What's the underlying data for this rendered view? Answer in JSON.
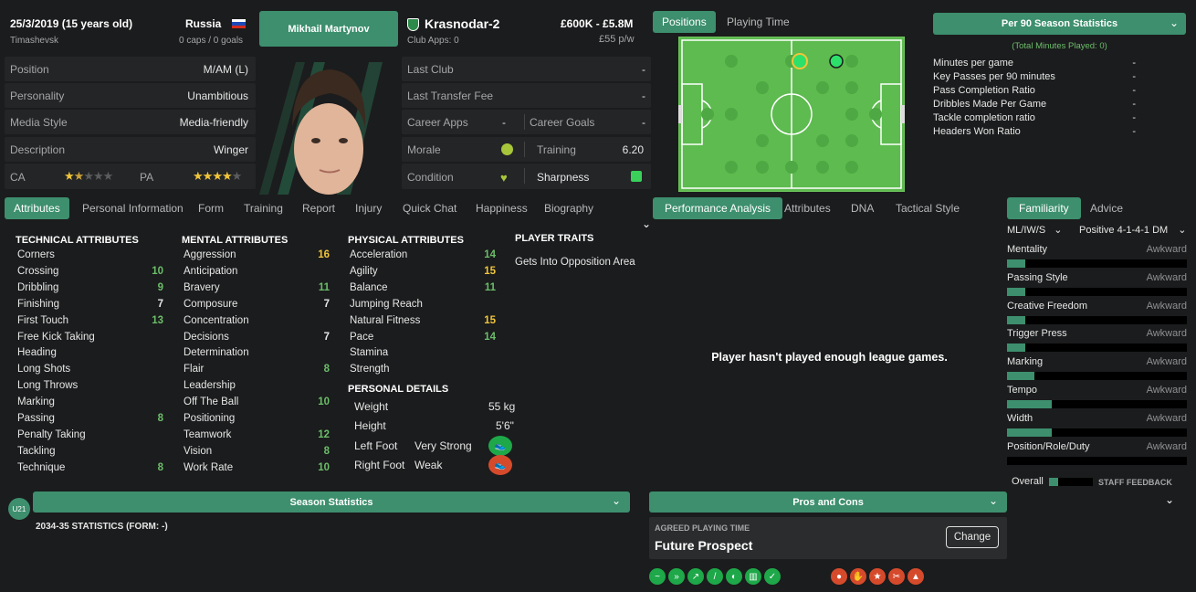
{
  "header": {
    "dob": "25/3/2019 (15 years old)",
    "birthplace": "Timashevsk",
    "nation": "Russia",
    "caps": "0 caps / 0 goals",
    "player_name": "Mikhail Martynov",
    "club": "Krasnodar-2",
    "club_apps": "Club Apps: 0",
    "value": "£600K - £5.8M",
    "wage": "£55 p/w"
  },
  "info_rows": [
    {
      "label": "Position",
      "value": "M/AM (L)"
    },
    {
      "label": "Personality",
      "value": "Unambitious"
    },
    {
      "label": "Media Style",
      "value": "Media-friendly"
    },
    {
      "label": "Description",
      "value": "Winger"
    }
  ],
  "ratings": {
    "ca_label": "CA",
    "pa_label": "PA",
    "ca_stars": 1.5,
    "pa_stars": 4
  },
  "club_rows": {
    "last_club_label": "Last Club",
    "last_club_value": "-",
    "last_fee_label": "Last Transfer Fee",
    "last_fee_value": "-",
    "career_apps_label": "Career Apps",
    "career_apps_value": "-",
    "career_goals_label": "Career Goals",
    "career_goals_value": "-",
    "morale_label": "Morale",
    "training_label": "Training",
    "training_value": "6.20",
    "condition_label": "Condition",
    "sharpness_label": "Sharpness"
  },
  "position_tabs": [
    "Positions",
    "Playing Time"
  ],
  "per90": {
    "title": "Per 90 Season Statistics",
    "subtitle": "(Total Minutes Played: 0)",
    "stats": [
      {
        "label": "Minutes per game",
        "value": "-"
      },
      {
        "label": "Key Passes per 90 minutes",
        "value": "-"
      },
      {
        "label": "Pass Completion Ratio",
        "value": "-"
      },
      {
        "label": "Dribbles Made Per Game",
        "value": "-"
      },
      {
        "label": "Tackle completion ratio",
        "value": "-"
      },
      {
        "label": "Headers Won Ratio",
        "value": "-"
      }
    ]
  },
  "main_tabs": [
    "Attributes",
    "Personal Information",
    "Form",
    "Training",
    "Report",
    "Injury",
    "Quick Chat",
    "Happiness",
    "Biography"
  ],
  "perf_tabs": [
    "Performance Analysis",
    "Attributes",
    "DNA",
    "Tactical Style"
  ],
  "fam_tabs": [
    "Familiarity",
    "Advice"
  ],
  "technical": {
    "title": "TECHNICAL ATTRIBUTES",
    "items": [
      {
        "label": "Corners",
        "value": ""
      },
      {
        "label": "Crossing",
        "value": "10"
      },
      {
        "label": "Dribbling",
        "value": "9"
      },
      {
        "label": "Finishing",
        "value": "7"
      },
      {
        "label": "First Touch",
        "value": "13"
      },
      {
        "label": "Free Kick Taking",
        "value": ""
      },
      {
        "label": "Heading",
        "value": ""
      },
      {
        "label": "Long Shots",
        "value": ""
      },
      {
        "label": "Long Throws",
        "value": ""
      },
      {
        "label": "Marking",
        "value": ""
      },
      {
        "label": "Passing",
        "value": "8"
      },
      {
        "label": "Penalty Taking",
        "value": ""
      },
      {
        "label": "Tackling",
        "value": ""
      },
      {
        "label": "Technique",
        "value": "8"
      }
    ]
  },
  "mental": {
    "title": "MENTAL ATTRIBUTES",
    "items": [
      {
        "label": "Aggression",
        "value": "16"
      },
      {
        "label": "Anticipation",
        "value": ""
      },
      {
        "label": "Bravery",
        "value": "11"
      },
      {
        "label": "Composure",
        "value": "7"
      },
      {
        "label": "Concentration",
        "value": ""
      },
      {
        "label": "Decisions",
        "value": "7"
      },
      {
        "label": "Determination",
        "value": ""
      },
      {
        "label": "Flair",
        "value": "8"
      },
      {
        "label": "Leadership",
        "value": ""
      },
      {
        "label": "Off The Ball",
        "value": "10"
      },
      {
        "label": "Positioning",
        "value": ""
      },
      {
        "label": "Teamwork",
        "value": "12"
      },
      {
        "label": "Vision",
        "value": "8"
      },
      {
        "label": "Work Rate",
        "value": "10"
      }
    ]
  },
  "physical": {
    "title": "PHYSICAL ATTRIBUTES",
    "items": [
      {
        "label": "Acceleration",
        "value": "14"
      },
      {
        "label": "Agility",
        "value": "15"
      },
      {
        "label": "Balance",
        "value": "11"
      },
      {
        "label": "Jumping Reach",
        "value": ""
      },
      {
        "label": "Natural Fitness",
        "value": "15"
      },
      {
        "label": "Pace",
        "value": "14"
      },
      {
        "label": "Stamina",
        "value": ""
      },
      {
        "label": "Strength",
        "value": ""
      }
    ]
  },
  "personal": {
    "title": "PERSONAL DETAILS",
    "weight_label": "Weight",
    "weight_value": "55 kg",
    "height_label": "Height",
    "height_value": "5'6\"",
    "left_foot_label": "Left Foot",
    "left_foot_value": "Very Strong",
    "right_foot_label": "Right Foot",
    "right_foot_value": "Weak"
  },
  "traits": {
    "title": "PLAYER TRAITS",
    "items": [
      "Gets Into Opposition Area"
    ]
  },
  "performance": {
    "message": "Player hasn't played enough league games."
  },
  "familiarity": {
    "role_select": "ML/IW/S",
    "tactic_select": "Positive 4-1-4-1 DM",
    "items": [
      {
        "label": "Mentality",
        "rating": "Awkward",
        "level": 0.1
      },
      {
        "label": "Passing Style",
        "rating": "Awkward",
        "level": 0.1
      },
      {
        "label": "Creative Freedom",
        "rating": "Awkward",
        "level": 0.1
      },
      {
        "label": "Trigger Press",
        "rating": "Awkward",
        "level": 0.1
      },
      {
        "label": "Marking",
        "rating": "Awkward",
        "level": 0.15
      },
      {
        "label": "Tempo",
        "rating": "Awkward",
        "level": 0.25
      },
      {
        "label": "Width",
        "rating": "Awkward",
        "level": 0.25
      },
      {
        "label": "Position/Role/Duty",
        "rating": "Awkward",
        "level": 0
      }
    ],
    "overall_label": "Overall",
    "staff_feedback": "STAFF FEEDBACK"
  },
  "season": {
    "badge": "U21",
    "title": "Season Statistics",
    "subtitle": "2034-35 STATISTICS (FORM: -)"
  },
  "pros_cons": {
    "title": "Pros and Cons",
    "agreed_label": "AGREED PLAYING TIME",
    "agreed_value": "Future Prospect",
    "change_label": "Change"
  },
  "colors": {
    "accent": "#3d8f6e",
    "good": "#6bbd6a",
    "high": "#f0c53a",
    "pitch": "#5dbb4f",
    "con": "#d64a2c"
  }
}
